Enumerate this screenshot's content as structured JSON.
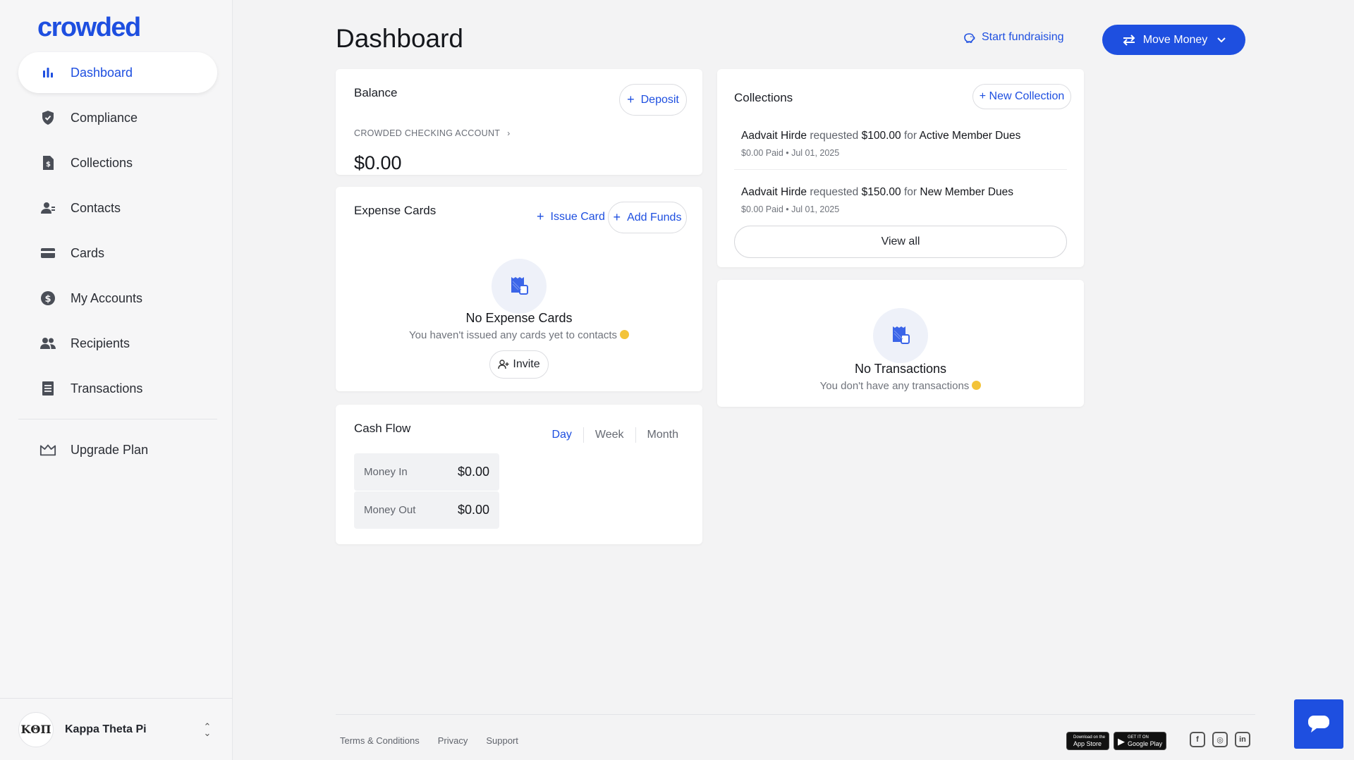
{
  "brand": {
    "logo_text": "crowded",
    "accent": "#1e4fe0"
  },
  "sidebar": {
    "items": [
      {
        "label": "Dashboard",
        "icon": "bar-chart-icon",
        "active": true
      },
      {
        "label": "Compliance",
        "icon": "shield-icon"
      },
      {
        "label": "Collections",
        "icon": "dollar-document-icon"
      },
      {
        "label": "Contacts",
        "icon": "contacts-icon"
      },
      {
        "label": "Cards",
        "icon": "credit-card-icon"
      },
      {
        "label": "My Accounts",
        "icon": "dollar-circle-icon"
      },
      {
        "label": "Recipients",
        "icon": "people-icon"
      },
      {
        "label": "Transactions",
        "icon": "list-icon"
      }
    ],
    "upgrade": {
      "label": "Upgrade Plan",
      "icon": "crown-icon"
    },
    "org": {
      "avatar_text": "ΚΘΠ",
      "name": "Kappa Theta Pi"
    }
  },
  "header": {
    "title": "Dashboard",
    "start_fundraising": "Start fundraising",
    "move_money": "Move Money"
  },
  "balance": {
    "title": "Balance",
    "deposit_label": "Deposit",
    "account_label": "CROWDED CHECKING ACCOUNT",
    "amount": "$0.00"
  },
  "expense_cards": {
    "title": "Expense Cards",
    "issue_card": "Issue Card",
    "add_funds": "Add Funds",
    "empty_title": "No Expense Cards",
    "empty_sub": "You haven't issued any cards yet to contacts",
    "invite": "Invite"
  },
  "cash_flow": {
    "title": "Cash Flow",
    "tabs": [
      "Day",
      "Week",
      "Month"
    ],
    "active_tab": "Day",
    "money_in_label": "Money In",
    "money_in_value": "$0.00",
    "money_out_label": "Money Out",
    "money_out_value": "$0.00"
  },
  "collections": {
    "title": "Collections",
    "new_collection": "+ New Collection",
    "items": [
      {
        "name": "Aadvait Hirde",
        "verb": "requested",
        "amount": "$100.00",
        "prep": "for",
        "purpose": "Active Member Dues",
        "meta": "$0.00 Paid • Jul 01, 2025"
      },
      {
        "name": "Aadvait Hirde",
        "verb": "requested",
        "amount": "$150.00",
        "prep": "for",
        "purpose": "New Member Dues",
        "meta": "$0.00 Paid • Jul 01, 2025"
      }
    ],
    "view_all": "View all"
  },
  "transactions": {
    "empty_title": "No Transactions",
    "empty_sub": "You don't have any transactions"
  },
  "footer": {
    "links": [
      "Terms & Conditions",
      "Privacy",
      "Support"
    ],
    "app_store_small": "Download on the",
    "app_store": "App Store",
    "google_play_small": "GET IT ON",
    "google_play": "Google Play"
  }
}
